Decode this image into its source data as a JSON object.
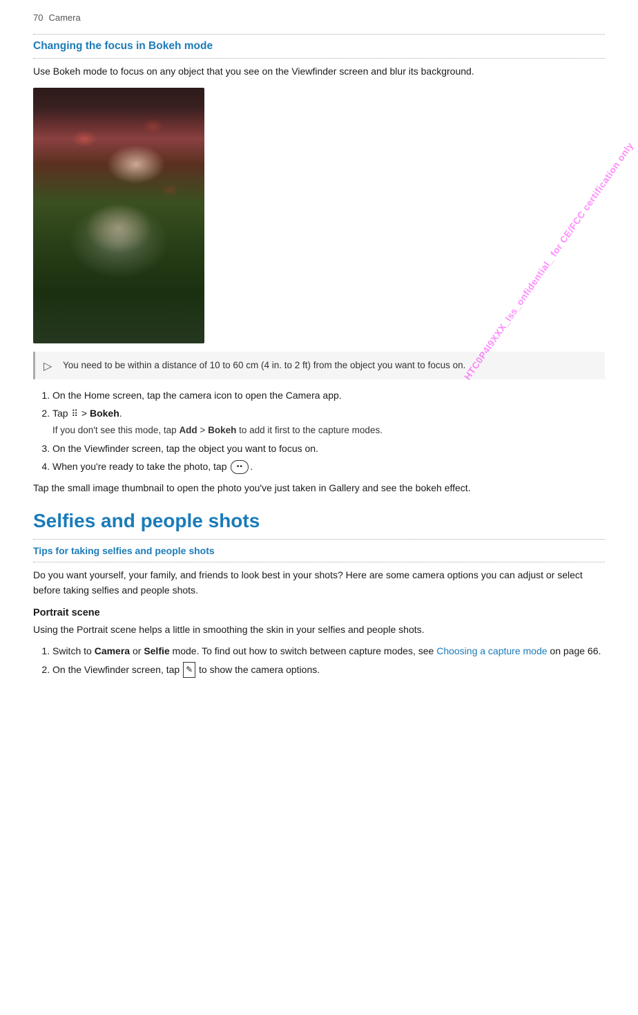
{
  "header": {
    "page_number": "70",
    "chapter": "Camera"
  },
  "watermark": "HTC0P4I9XXX_Iss_onfidential_ for CE/FCC certification only",
  "section1": {
    "heading": "Changing the focus in Bokeh mode",
    "intro": "Use Bokeh mode to focus on any object that you see on the Viewfinder screen and blur its background.",
    "note": "You need to be within a distance of 10 to 60 cm (4 in. to 2 ft) from the object you want to focus on.",
    "steps": [
      {
        "text": "On the Home screen, tap the camera icon to open the Camera app."
      },
      {
        "text": "Tap",
        "icon": "grid",
        "bold_part": "Bokeh",
        "sub": "If you don't see this mode, tap Add > Bokeh to add it first to the capture modes."
      },
      {
        "text": "On the Viewfinder screen, tap the object you want to focus on."
      },
      {
        "text": "When you're ready to take the photo, tap",
        "icon": "shutter"
      }
    ],
    "outro": "Tap the small image thumbnail to open the photo you've just taken in Gallery and see the bokeh effect."
  },
  "section2": {
    "large_heading": "Selfies and people shots",
    "sub_heading": "Tips for taking selfies and people shots",
    "intro": "Do you want yourself, your family, and friends to look best in your shots? Here are some camera options you can adjust or select before taking selfies and people shots.",
    "portrait_label": "Portrait scene",
    "portrait_text": "Using the Portrait scene helps a little in smoothing the skin in your selfies and people shots.",
    "portrait_steps": [
      {
        "text": "Switch to Camera or Selfie mode. To find out how to switch between capture modes, see Choosing a capture mode on page 66.",
        "link_text": "Choosing a capture mode",
        "link_page": "page 66"
      },
      {
        "text": "On the Viewfinder screen, tap",
        "icon": "menu",
        "after": "to show the camera options."
      }
    ]
  },
  "labels": {
    "add": "Add",
    "bokeh": "Bokeh",
    "camera": "Camera",
    "selfie": "Selfie",
    "choosing_link": "Choosing a capture mode"
  }
}
